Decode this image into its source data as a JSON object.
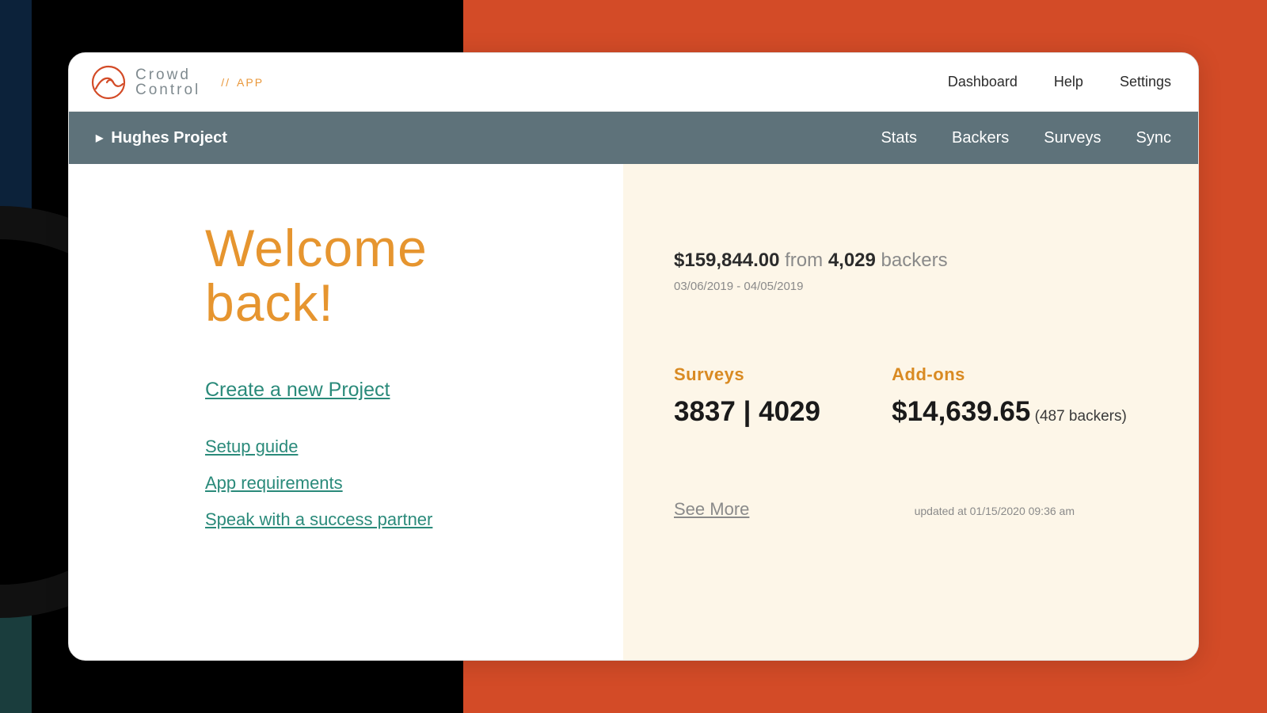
{
  "brand": {
    "line1": "Crowd",
    "line2": "Control",
    "slashes": "//",
    "sub": "APP"
  },
  "topnav": {
    "dashboard": "Dashboard",
    "help": "Help",
    "settings": "Settings"
  },
  "projbar": {
    "project_name": "Hughes Project",
    "stats": "Stats",
    "backers": "Backers",
    "surveys": "Surveys",
    "sync": "Sync"
  },
  "welcome": {
    "line1": "Welcome",
    "line2": "back!"
  },
  "links": {
    "create": "Create a new Project",
    "setup": "Setup guide",
    "requirements": "App requirements",
    "speak": "Speak with a success partner"
  },
  "summary": {
    "amount": "$159,844.00",
    "from_word": " from ",
    "backers_count": "4,029",
    "backers_word": " backers",
    "date_range": "03/06/2019 - 04/05/2019"
  },
  "stats": {
    "surveys_label": "Surveys",
    "surveys_value": "3837 | 4029",
    "addons_label": "Add-ons",
    "addons_value": "$14,639.65",
    "addons_sub": " (487 backers)"
  },
  "footer": {
    "see_more": "See More",
    "updated": "updated at 01/15/2020 09:36 am"
  }
}
